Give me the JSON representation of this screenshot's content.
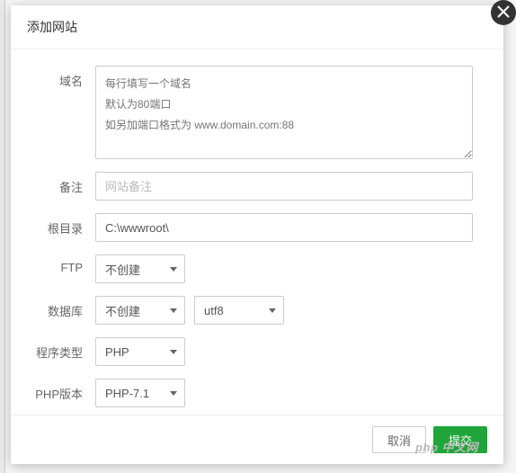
{
  "dialog": {
    "title": "添加网站",
    "close_aria": "关闭"
  },
  "form": {
    "domain": {
      "label": "域名",
      "placeholder": "每行填写一个域名\n默认为80端口\n如另加端口格式为 www.domain.com:88"
    },
    "remark": {
      "label": "备注",
      "placeholder": "网站备注",
      "value": ""
    },
    "root": {
      "label": "根目录",
      "value": "C:\\wwwroot\\"
    },
    "ftp": {
      "label": "FTP",
      "selected": "不创建"
    },
    "database": {
      "label": "数据库",
      "selected": "不创建",
      "charset": "utf8"
    },
    "program_type": {
      "label": "程序类型",
      "selected": "PHP"
    },
    "php_version": {
      "label": "PHP版本",
      "selected": "PHP-7.1"
    }
  },
  "footer": {
    "cancel": "取消",
    "submit": "提交"
  },
  "watermark": "php 中文网"
}
